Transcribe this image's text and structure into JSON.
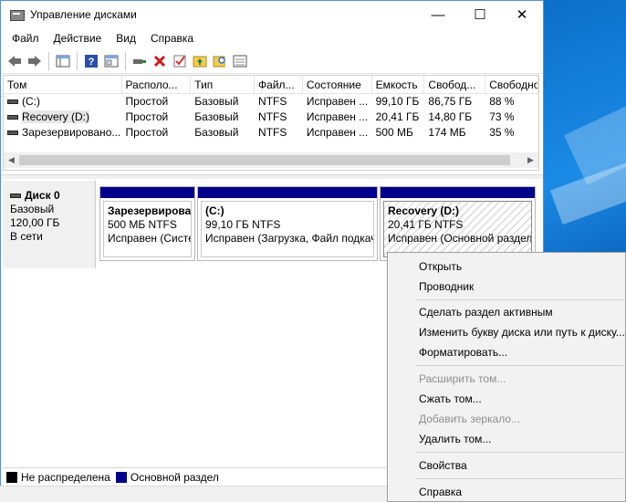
{
  "window": {
    "title": "Управление дисками",
    "minimize": "—",
    "maximize": "☐",
    "close": "✕"
  },
  "menu": [
    "Файл",
    "Действие",
    "Вид",
    "Справка"
  ],
  "volumes": {
    "columns": [
      "Том",
      "Располо...",
      "Тип",
      "Файл...",
      "Состояние",
      "Емкость",
      "Свобод...",
      "Свободно"
    ],
    "rows": [
      [
        "(C:)",
        "Простой",
        "Базовый",
        "NTFS",
        "Исправен ...",
        "99,10 ГБ",
        "86,75 ГБ",
        "88 %"
      ],
      [
        "Recovery (D:)",
        "Простой",
        "Базовый",
        "NTFS",
        "Исправен ...",
        "20,41 ГБ",
        "14,80 ГБ",
        "73 %"
      ],
      [
        "Зарезервировано...",
        "Простой",
        "Базовый",
        "NTFS",
        "Исправен ...",
        "500 МБ",
        "174 МБ",
        "35 %"
      ]
    ]
  },
  "disk": {
    "name": "Диск 0",
    "type": "Базовый",
    "size": "120,00 ГБ",
    "status": "В сети",
    "partitions": [
      {
        "name": "Зарезервирова",
        "size": "500 МБ NTFS",
        "status": "Исправен (Систе"
      },
      {
        "name": "(C:)",
        "size": "99,10 ГБ NTFS",
        "status": "Исправен (Загрузка, Файл подкач"
      },
      {
        "name": "Recovery  (D:)",
        "size": "20,41 ГБ NTFS",
        "status": "Исправен (Основной раздел"
      }
    ]
  },
  "legend": {
    "unallocated": "Не распределена",
    "primary": "Основной раздел",
    "unallocated_color": "#000000",
    "primary_color": "#00008b"
  },
  "context_menu": {
    "open": "Открыть",
    "explorer": "Проводник",
    "mark_active": "Сделать раздел активным",
    "change_letter": "Изменить букву диска или путь к диску...",
    "format": "Форматировать...",
    "extend": "Расширить том...",
    "shrink": "Сжать том...",
    "add_mirror": "Добавить зеркало...",
    "delete": "Удалить том...",
    "properties": "Свойства",
    "help": "Справка"
  },
  "colors": {
    "accent_arrow": "#e0302a",
    "partition_bar": "#00008b"
  }
}
